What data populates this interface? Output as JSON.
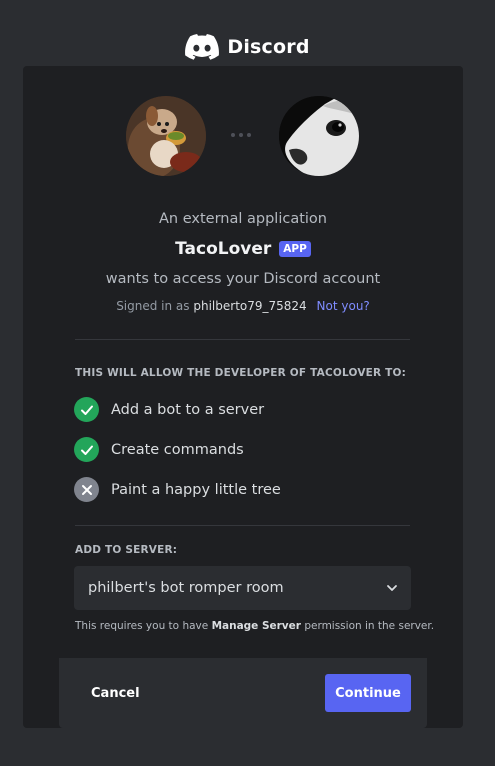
{
  "brand": {
    "name": "Discord",
    "icon": "discord-logo-icon"
  },
  "header": {
    "intro": "An external application",
    "app_name": "TacoLover",
    "app_badge": "APP",
    "wants": "wants to access your Discord account",
    "signed_in_prefix": "Signed in as",
    "username": "philberto79_75824",
    "not_you": "Not you?"
  },
  "permissions": {
    "title": "THIS WILL ALLOW THE DEVELOPER OF TACOLOVER TO:",
    "items": [
      {
        "label": "Add a bot to a server",
        "granted": true,
        "icon": "check-icon"
      },
      {
        "label": "Create commands",
        "granted": true,
        "icon": "check-icon"
      },
      {
        "label": "Paint a happy little tree",
        "granted": false,
        "icon": "x-icon"
      }
    ]
  },
  "server": {
    "title": "ADD TO SERVER:",
    "selected": "philbert's bot romper room",
    "note_prefix": "This requires you to have",
    "note_permission": "Manage Server",
    "note_suffix": "permission in the server."
  },
  "footer": {
    "cancel_label": "Cancel",
    "continue_label": "Continue"
  },
  "colors": {
    "accent": "#5865f2",
    "success": "#23a55a",
    "denied": "#80848e",
    "link": "#7f8cff",
    "card_bg": "#1e1f22",
    "page_bg": "#2b2d31"
  }
}
